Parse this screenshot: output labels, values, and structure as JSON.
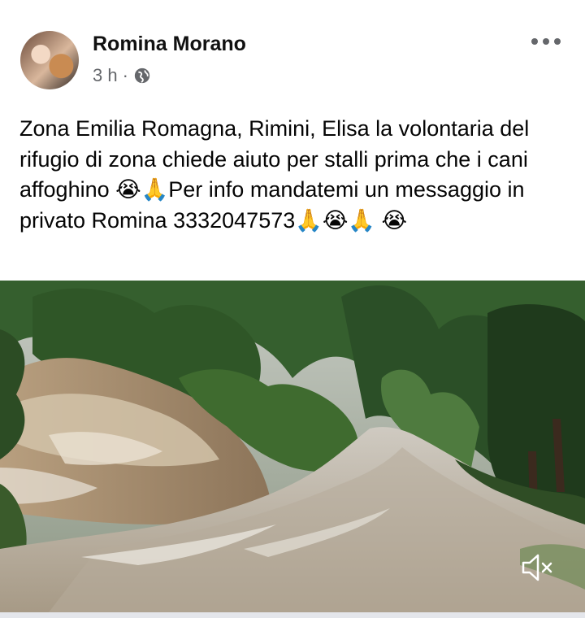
{
  "post": {
    "author": "Romina Morano",
    "time": "3 h",
    "separator": "·",
    "text": "Zona Emilia Romagna, Rimini, Elisa la volontaria del rifugio di zona chiede aiuto per stalli prima che i cani affoghino 😭🙏Per info mandatemi un messaggio in privato Romina 3332047573🙏😭🙏 😭"
  },
  "icons": {
    "privacy": "globe-icon",
    "more": "more-options-icon",
    "mute": "volume-muted-icon"
  },
  "colors": {
    "author_text": "#111111",
    "meta_text": "#65676b",
    "body_text": "#050505"
  }
}
